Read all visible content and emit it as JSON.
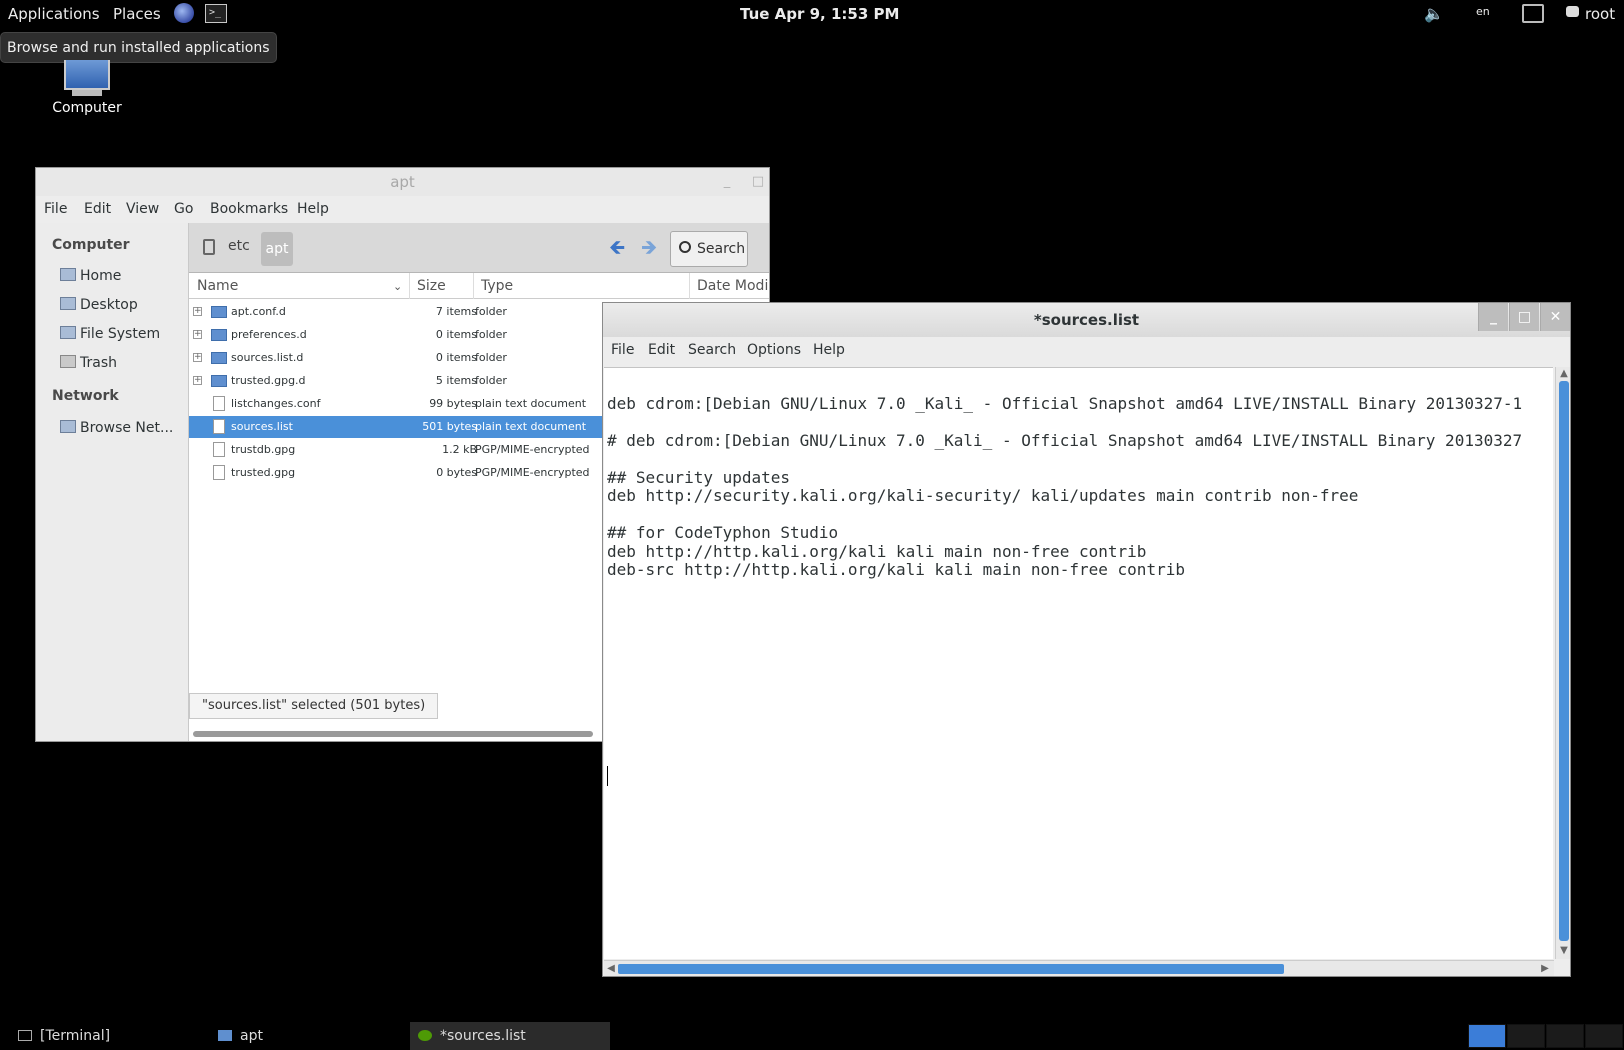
{
  "top_panel": {
    "applications": "Applications",
    "places": "Places",
    "clock": "Tue Apr  9,  1:53 PM",
    "language": "en",
    "user": "root",
    "tooltip": "Browse and run installed applications"
  },
  "desktop": {
    "computer_label": "Computer"
  },
  "file_manager": {
    "title": "apt",
    "menu": [
      "File",
      "Edit",
      "View",
      "Go",
      "Bookmarks",
      "Help"
    ],
    "sidebar": {
      "computer_heading": "Computer",
      "computer_items": [
        "Home",
        "Desktop",
        "File System",
        "Trash"
      ],
      "network_heading": "Network",
      "network_items": [
        "Browse Net..."
      ]
    },
    "breadcrumb": [
      "etc",
      "apt"
    ],
    "search_label": "Search",
    "columns": [
      "Name",
      "Size",
      "Type",
      "Date Modi"
    ],
    "rows": [
      {
        "name": "apt.conf.d",
        "size": "7 items",
        "type": "folder",
        "kind": "folder",
        "expander": true
      },
      {
        "name": "preferences.d",
        "size": "0 items",
        "type": "folder",
        "kind": "folder",
        "expander": true
      },
      {
        "name": "sources.list.d",
        "size": "0 items",
        "type": "folder",
        "kind": "folder",
        "expander": true
      },
      {
        "name": "trusted.gpg.d",
        "size": "5 items",
        "type": "folder",
        "kind": "folder",
        "expander": true
      },
      {
        "name": "listchanges.conf",
        "size": "99 bytes",
        "type": "plain text document",
        "kind": "file",
        "expander": false
      },
      {
        "name": "sources.list",
        "size": "501 bytes",
        "type": "plain text document",
        "kind": "file",
        "expander": false,
        "selected": true
      },
      {
        "name": "trustdb.gpg",
        "size": "1.2 kB",
        "type": "PGP/MIME-encrypted",
        "kind": "file",
        "expander": false
      },
      {
        "name": "trusted.gpg",
        "size": "0 bytes",
        "type": "PGP/MIME-encrypted",
        "kind": "file",
        "expander": false
      }
    ],
    "status": "\"sources.list\" selected (501 bytes)"
  },
  "editor": {
    "title": "*sources.list",
    "menu": [
      "File",
      "Edit",
      "Search",
      "Options",
      "Help"
    ],
    "lines": [
      "",
      "deb cdrom:[Debian GNU/Linux 7.0 _Kali_ - Official Snapshot amd64 LIVE/INSTALL Binary 20130327-1",
      "",
      "# deb cdrom:[Debian GNU/Linux 7.0 _Kali_ - Official Snapshot amd64 LIVE/INSTALL Binary 20130327",
      "",
      "## Security updates",
      "deb http://security.kali.org/kali-security/ kali/updates main contrib non-free",
      "",
      "## for CodeTyphon Studio",
      "deb http://http.kali.org/kali kali main non-free contrib",
      "deb-src http://http.kali.org/kali kali main non-free contrib"
    ]
  },
  "taskbar": {
    "tasks": [
      "[Terminal]",
      "apt",
      "*sources.list"
    ]
  },
  "colors": {
    "selection": "#4a90d9",
    "desktop": "#000000"
  }
}
